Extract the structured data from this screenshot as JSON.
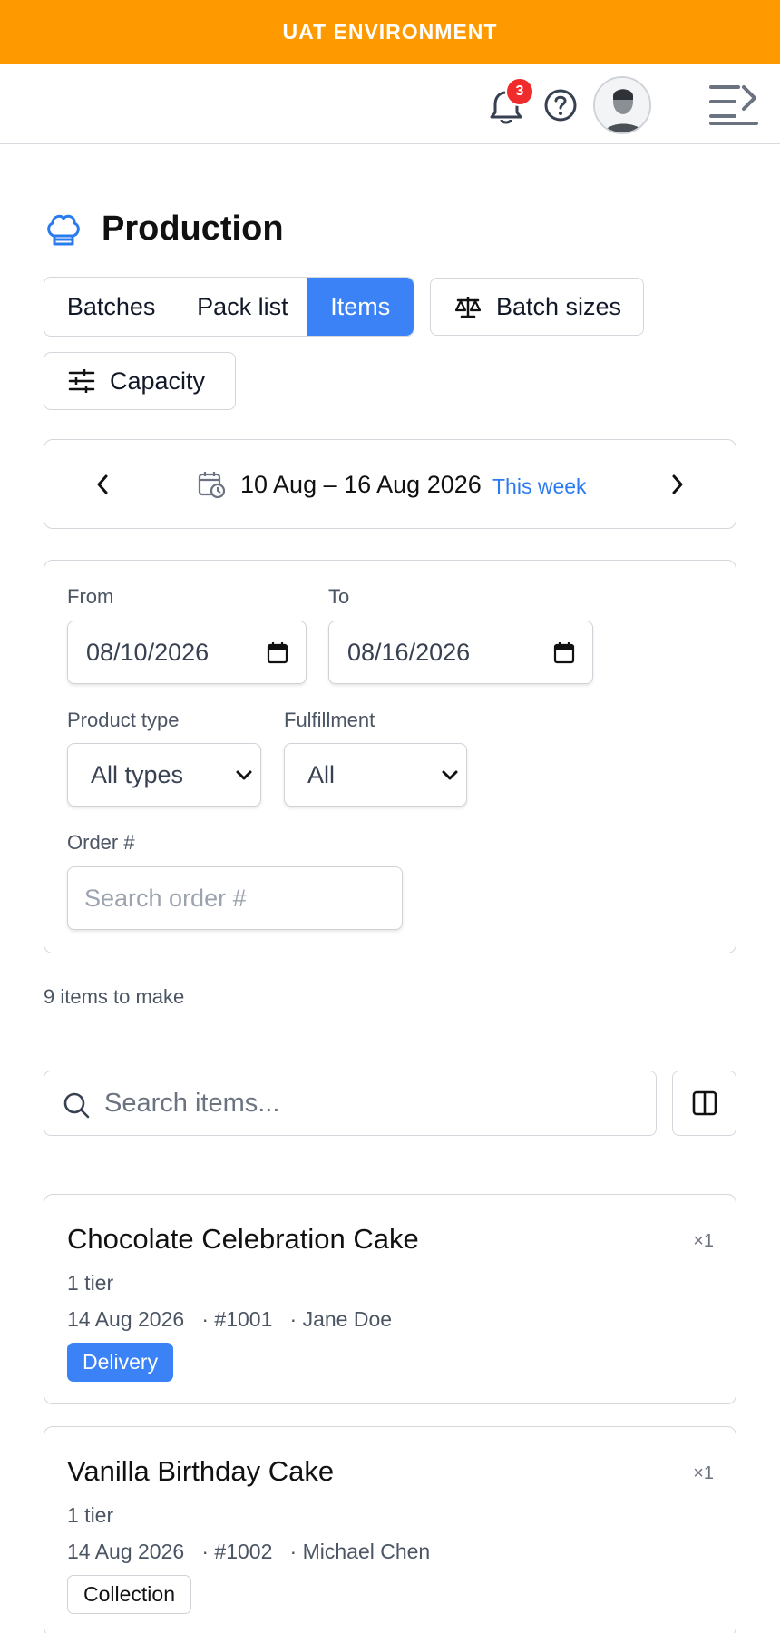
{
  "banner": {
    "text": "UAT ENVIRONMENT"
  },
  "header": {
    "notification_count": "3",
    "icons": [
      "bell-icon",
      "help-icon",
      "avatar",
      "menu-toggle-icon"
    ]
  },
  "page": {
    "title": "Production",
    "icon": "chef-hat-icon"
  },
  "tabs": [
    {
      "label": "Batches",
      "active": false
    },
    {
      "label": "Pack list",
      "active": false
    },
    {
      "label": "Items",
      "active": true
    }
  ],
  "actions": {
    "batch_sizes": "Batch sizes",
    "capacity": "Capacity"
  },
  "week": {
    "range": "10 Aug – 16 Aug 2026",
    "this_week": "This week"
  },
  "filters": {
    "from_label": "From",
    "from_value": "08/10/2026",
    "to_label": "To",
    "to_value": "08/16/2026",
    "product_type_label": "Product type",
    "product_type_value": "All types",
    "fulfillment_label": "Fulfillment",
    "fulfillment_value": "All",
    "order_label": "Order #",
    "order_placeholder": "Search order #"
  },
  "summary": {
    "count_text": "9 items to make"
  },
  "search": {
    "placeholder": "Search items..."
  },
  "items": [
    {
      "name": "Chocolate Celebration Cake",
      "qty": "×1",
      "tier": "1 tier",
      "date": "14 Aug 2026",
      "order": "· #1001",
      "customer": "· Jane Doe",
      "fulfillment": "Delivery"
    },
    {
      "name": "Vanilla Birthday Cake",
      "qty": "×1",
      "tier": "1 tier",
      "date": "14 Aug 2026",
      "order": "· #1002",
      "customer": "· Michael Chen",
      "fulfillment": "Collection"
    }
  ],
  "colors": {
    "banner": "#ff9900",
    "accent": "#3b82f6",
    "badge": "#ef2b2b",
    "link": "#2b7bf0"
  }
}
